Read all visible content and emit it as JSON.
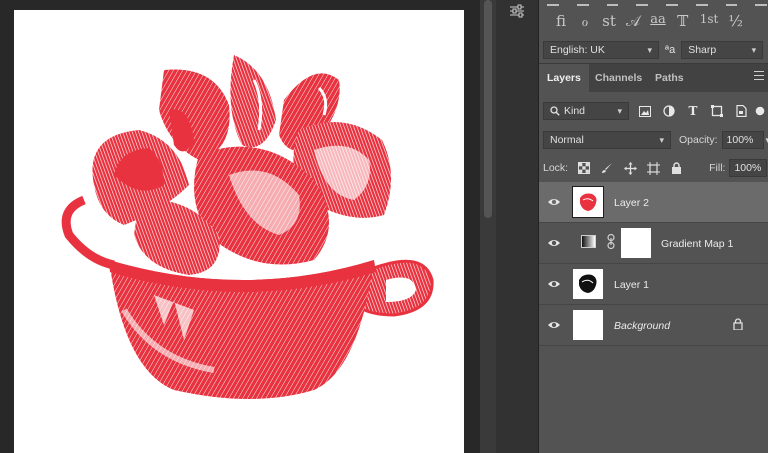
{
  "typography": {
    "glyphs": [
      "fi",
      "ℴ",
      "st",
      "𝒜",
      "aa",
      "𝕋",
      "1st",
      "½"
    ],
    "language": "English: UK",
    "aa_label": "ªa",
    "antialias": "Sharp"
  },
  "layers_panel": {
    "tabs": [
      {
        "label": "Layers"
      },
      {
        "label": "Channels"
      },
      {
        "label": "Paths"
      }
    ],
    "filter_kind": "Kind",
    "blend_mode": "Normal",
    "opacity_label": "Opacity:",
    "opacity_value": "100%",
    "lock_label": "Lock:",
    "fill_label": "Fill:",
    "fill_value": "100%",
    "layers": [
      {
        "name": "Layer 2",
        "selected": true
      },
      {
        "name": "Gradient Map 1",
        "selected": false
      },
      {
        "name": "Layer 1",
        "selected": false
      },
      {
        "name": "Background",
        "selected": false
      }
    ]
  },
  "colors": {
    "artwork_red": "#e8323f",
    "panel_bg": "#535353",
    "selected_layer": "#6b6b6b"
  }
}
